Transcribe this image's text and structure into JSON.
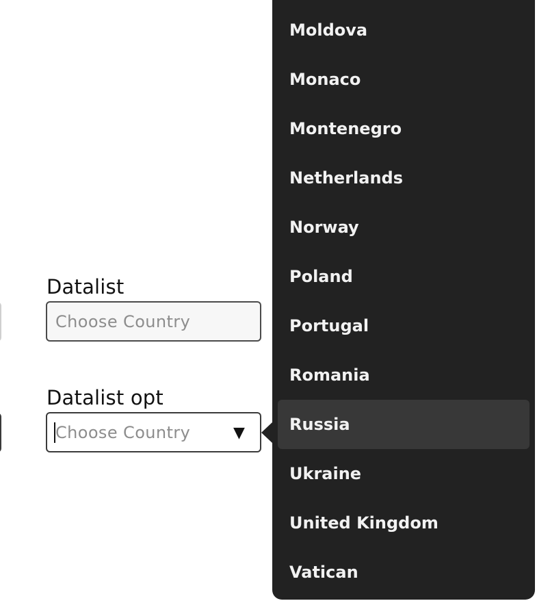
{
  "form": {
    "datalist_label": "Datalist",
    "datalist_placeholder": "Choose Country",
    "datalist_opt_label": "Datalist opt",
    "datalist_opt_placeholder": "Choose Country",
    "dropdown_arrow": "▼"
  },
  "popup": {
    "options": [
      {
        "label": "Moldova",
        "selected": false
      },
      {
        "label": "Monaco",
        "selected": false
      },
      {
        "label": "Montenegro",
        "selected": false
      },
      {
        "label": "Netherlands",
        "selected": false
      },
      {
        "label": "Norway",
        "selected": false
      },
      {
        "label": "Poland",
        "selected": false
      },
      {
        "label": "Portugal",
        "selected": false
      },
      {
        "label": "Romania",
        "selected": false
      },
      {
        "label": "Russia",
        "selected": true
      },
      {
        "label": "Ukraine",
        "selected": false
      },
      {
        "label": "United Kingdom",
        "selected": false
      },
      {
        "label": "Vatican",
        "selected": false
      }
    ]
  },
  "colors": {
    "popup_background": "#222222",
    "popup_highlight": "#383838",
    "popup_text": "#f2f2f2"
  }
}
